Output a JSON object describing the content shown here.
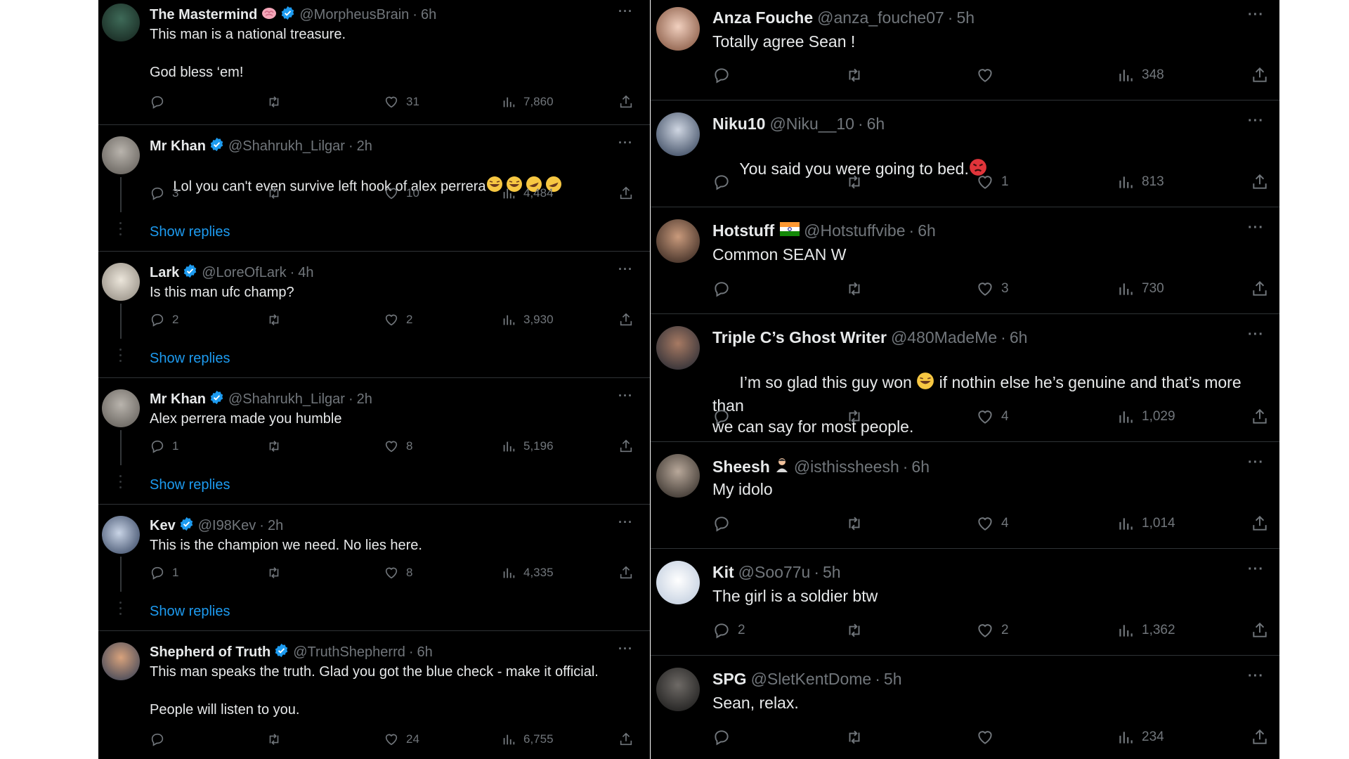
{
  "colors": {
    "background": "#000000",
    "text": "#e7e9ea",
    "muted": "#71767b",
    "link": "#1d9bf0",
    "verified": "#1d9bf0",
    "divider": "#2f3336"
  },
  "icons": {
    "reply": "reply-icon",
    "repost": "repost-icon",
    "like": "like-icon",
    "views": "views-icon",
    "share": "share-icon",
    "more": "more-icon",
    "verified": "verified-badge-icon"
  },
  "more_label": "···",
  "left": {
    "tweets": [
      {
        "name": "The Mastermind",
        "handle": "@MorpheusBrain",
        "time": "6h",
        "text": "This man is a national treasure.\n\nGod bless ‘em!",
        "replies": "",
        "reposts": "",
        "likes": "31",
        "views": "7,860",
        "show_replies": ""
      },
      {
        "name": "Mr Khan",
        "handle": "@Shahrukh_Lilgar",
        "time": "2h",
        "text": "Lol you can't even survive left hook of alex perrera",
        "replies": "3",
        "reposts": "",
        "likes": "10",
        "views": "4,484",
        "show_replies": "Show replies"
      },
      {
        "name": "Lark",
        "handle": "@LoreOfLark",
        "time": "4h",
        "text": "Is this man ufc champ?",
        "replies": "2",
        "reposts": "",
        "likes": "2",
        "views": "3,930",
        "show_replies": "Show replies"
      },
      {
        "name": "Mr Khan",
        "handle": "@Shahrukh_Lilgar",
        "time": "2h",
        "text": "Alex perrera made you humble",
        "replies": "1",
        "reposts": "",
        "likes": "8",
        "views": "5,196",
        "show_replies": "Show replies"
      },
      {
        "name": "Kev",
        "handle": "@I98Kev",
        "time": "2h",
        "text": "This is the champion we need. No lies here.",
        "replies": "1",
        "reposts": "",
        "likes": "8",
        "views": "4,335",
        "show_replies": "Show replies"
      },
      {
        "name": "Shepherd of Truth",
        "handle": "@TruthShepherrd",
        "time": "6h",
        "text": "This man speaks the truth. Glad you got the blue check - make it official.\n\nPeople will listen to you.",
        "replies": "",
        "reposts": "",
        "likes": "24",
        "views": "6,755",
        "show_replies": ""
      }
    ]
  },
  "right": {
    "tweets": [
      {
        "name": "Anza Fouche",
        "handle": "@anza_fouche07",
        "time": "5h",
        "text": "Totally agree Sean !",
        "replies": "",
        "reposts": "",
        "likes": "",
        "views": "348"
      },
      {
        "name": "Niku10",
        "handle": "@Niku__10",
        "time": "6h",
        "text": "You said you were going to bed.",
        "replies": "",
        "reposts": "",
        "likes": "1",
        "views": "813"
      },
      {
        "name": "Hotstuff",
        "handle": "@Hotstuffvibe",
        "time": "6h",
        "text": "Common SEAN W",
        "replies": "",
        "reposts": "",
        "likes": "3",
        "views": "730"
      },
      {
        "name": "Triple C’s Ghost Writer",
        "handle": "@480MadeMe",
        "time": "6h",
        "text": "I’m so glad this guy won",
        "text_after_emoji": " if nothin else he’s genuine and that’s more than",
        "text_line2": "we can say for most people.",
        "replies": "",
        "reposts": "",
        "likes": "4",
        "views": "1,029"
      },
      {
        "name": "Sheesh",
        "handle": "@isthissheesh",
        "time": "6h",
        "text": "My idolo",
        "replies": "",
        "reposts": "",
        "likes": "4",
        "views": "1,014"
      },
      {
        "name": "Kit",
        "handle": "@Soo77u",
        "time": "5h",
        "text": "The girl is a soldier btw",
        "replies": "2",
        "reposts": "",
        "likes": "2",
        "views": "1,362"
      },
      {
        "name": "SPG",
        "handle": "@SletKentDome",
        "time": "5h",
        "text": "Sean, relax.",
        "replies": "",
        "reposts": "",
        "likes": "",
        "views": "234"
      }
    ]
  }
}
